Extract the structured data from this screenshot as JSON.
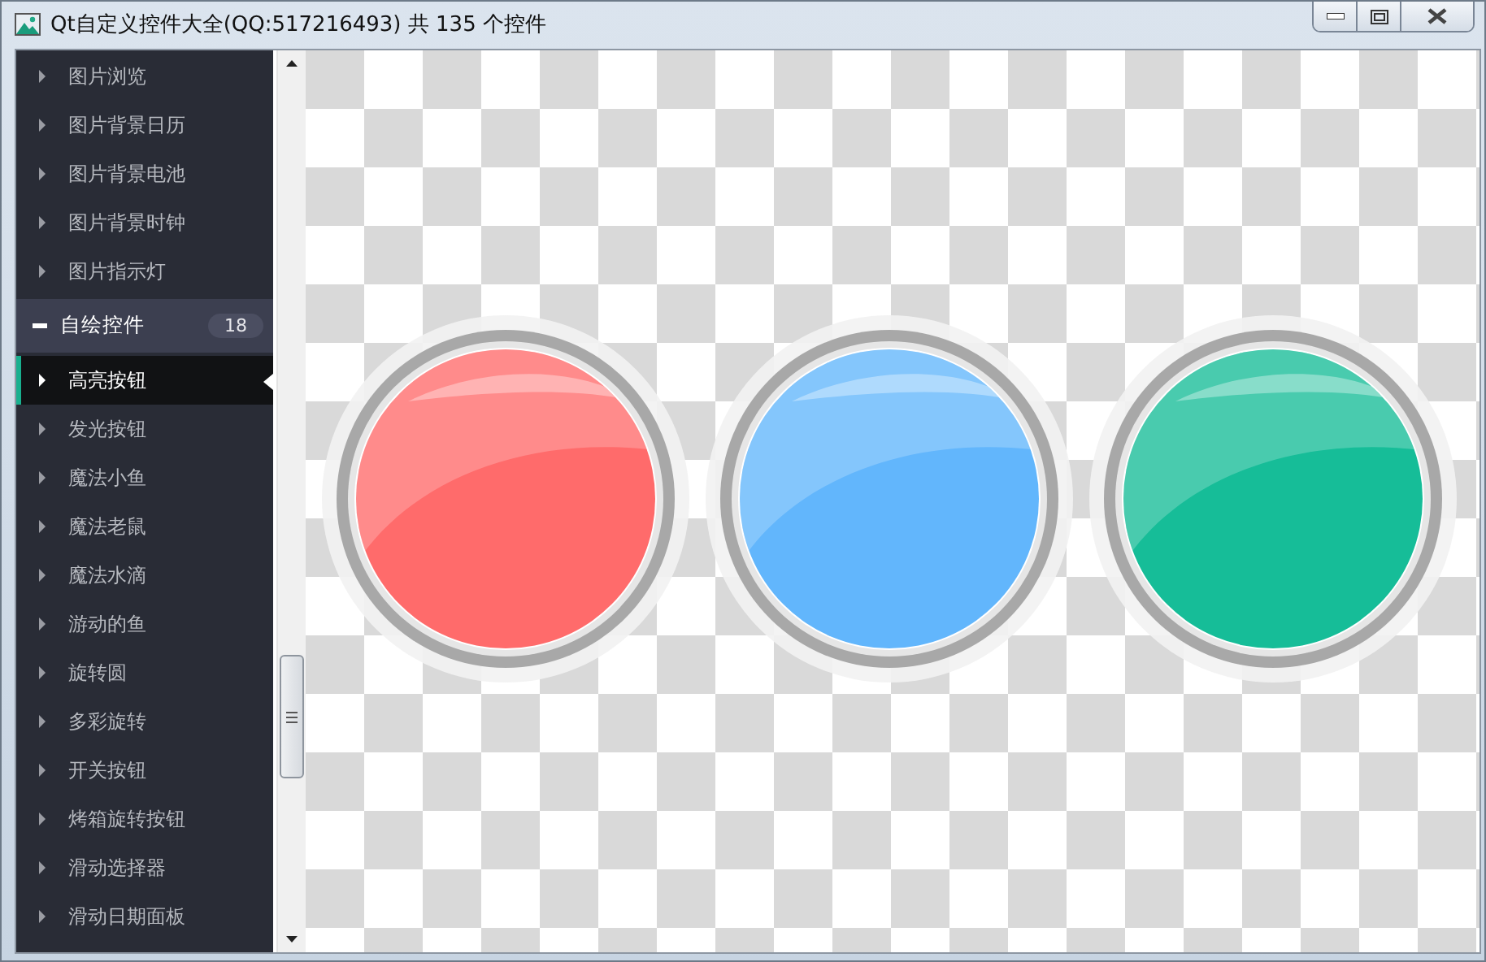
{
  "window": {
    "title": "Qt自定义控件大全(QQ:517216493) 共 135 个控件"
  },
  "tree": [
    {
      "kind": "leaf",
      "label": "图片浏览",
      "selected": false
    },
    {
      "kind": "leaf",
      "label": "图片背景日历",
      "selected": false
    },
    {
      "kind": "leaf",
      "label": "图片背景电池",
      "selected": false
    },
    {
      "kind": "leaf",
      "label": "图片背景时钟",
      "selected": false
    },
    {
      "kind": "leaf",
      "label": "图片指示灯",
      "selected": false
    },
    {
      "kind": "group",
      "label": "自绘控件",
      "count": "18",
      "expanded": true,
      "children": [
        {
          "kind": "leaf",
          "label": "高亮按钮",
          "selected": true
        },
        {
          "kind": "leaf",
          "label": "发光按钮",
          "selected": false
        },
        {
          "kind": "leaf",
          "label": "魔法小鱼",
          "selected": false
        },
        {
          "kind": "leaf",
          "label": "魔法老鼠",
          "selected": false
        },
        {
          "kind": "leaf",
          "label": "魔法水滴",
          "selected": false
        },
        {
          "kind": "leaf",
          "label": "游动的鱼",
          "selected": false
        },
        {
          "kind": "leaf",
          "label": "旋转圆",
          "selected": false
        },
        {
          "kind": "leaf",
          "label": "多彩旋转",
          "selected": false
        },
        {
          "kind": "leaf",
          "label": "开关按钮",
          "selected": false
        },
        {
          "kind": "leaf",
          "label": "烤箱旋转按钮",
          "selected": false
        },
        {
          "kind": "leaf",
          "label": "滑动选择器",
          "selected": false
        },
        {
          "kind": "leaf",
          "label": "滑动日期面板",
          "selected": false
        }
      ]
    }
  ],
  "lights": [
    {
      "color": "#ff6b6b"
    },
    {
      "color": "#62b6fc"
    },
    {
      "color": "#16bd98"
    }
  ]
}
